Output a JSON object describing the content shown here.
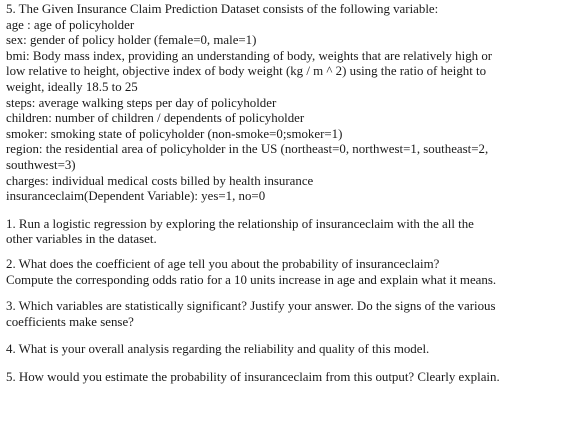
{
  "intro": {
    "title": "5. The Given Insurance Claim Prediction Dataset consists of the following variable:",
    "variables": [
      [
        "age : age of policyholder"
      ],
      [
        "sex: gender of policy holder (female=0, male=1)"
      ],
      [
        "bmi: Body mass index, providing an understanding of body, weights that are relatively high or",
        "low relative to height, objective index of body weight (kg / m ^ 2) using the ratio of height to",
        "weight, ideally 18.5 to 25"
      ],
      [
        "steps: average walking steps per day of policyholder"
      ],
      [
        "children: number of children / dependents of policyholder"
      ],
      [
        "smoker: smoking state of policyholder (non-smoke=0;smoker=1)"
      ],
      [
        "region: the residential area of policyholder in the US (northeast=0, northwest=1, southeast=2,",
        "southwest=3)"
      ],
      [
        "charges: individual medical costs billed by health insurance"
      ],
      [
        "insuranceclaim(Dependent Variable): yes=1, no=0"
      ]
    ]
  },
  "questions": [
    [
      "1. Run a logistic regression by exploring the relationship of insuranceclaim with the all the",
      "other variables in the dataset."
    ],
    [
      "2. What does the coefficient of age tell you about the probability of insuranceclaim?",
      "Compute the corresponding odds ratio for a 10 units increase in age and explain what it means."
    ],
    [
      "3. Which variables are statistically significant? Justify your answer. Do the signs of the various",
      "coefficients make sense?"
    ],
    [
      "4. What is your overall analysis regarding the reliability and quality of this model."
    ],
    [
      "5. How would you estimate the probability of insuranceclaim from this output? Clearly explain."
    ]
  ]
}
